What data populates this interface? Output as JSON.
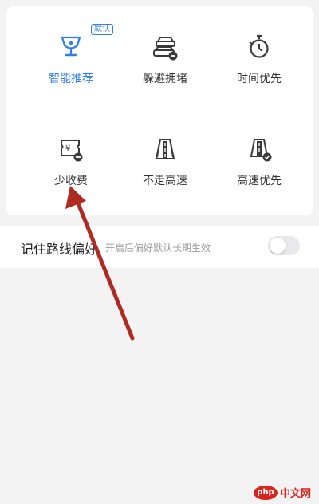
{
  "route_options": [
    {
      "label": "智能推荐",
      "icon": "trophy-icon",
      "selected": true,
      "badge": "默认"
    },
    {
      "label": "躲避拥堵",
      "icon": "car-jam-icon",
      "selected": false
    },
    {
      "label": "时间优先",
      "icon": "stopwatch-icon",
      "selected": false
    },
    {
      "label": "少收费",
      "icon": "toll-ticket-icon",
      "selected": false
    },
    {
      "label": "不走高速",
      "icon": "no-highway-icon",
      "selected": false
    },
    {
      "label": "高速优先",
      "icon": "highway-first-icon",
      "selected": false
    }
  ],
  "remember_pref": {
    "title": "记住路线偏好",
    "subtitle": "开启后偏好默认长期生效",
    "enabled": false
  },
  "watermark": {
    "logo": "php",
    "text": "中文网"
  },
  "colors": {
    "accent": "#2f7fe4",
    "arrow": "#b02a24",
    "icon": "#3a3a3a"
  }
}
